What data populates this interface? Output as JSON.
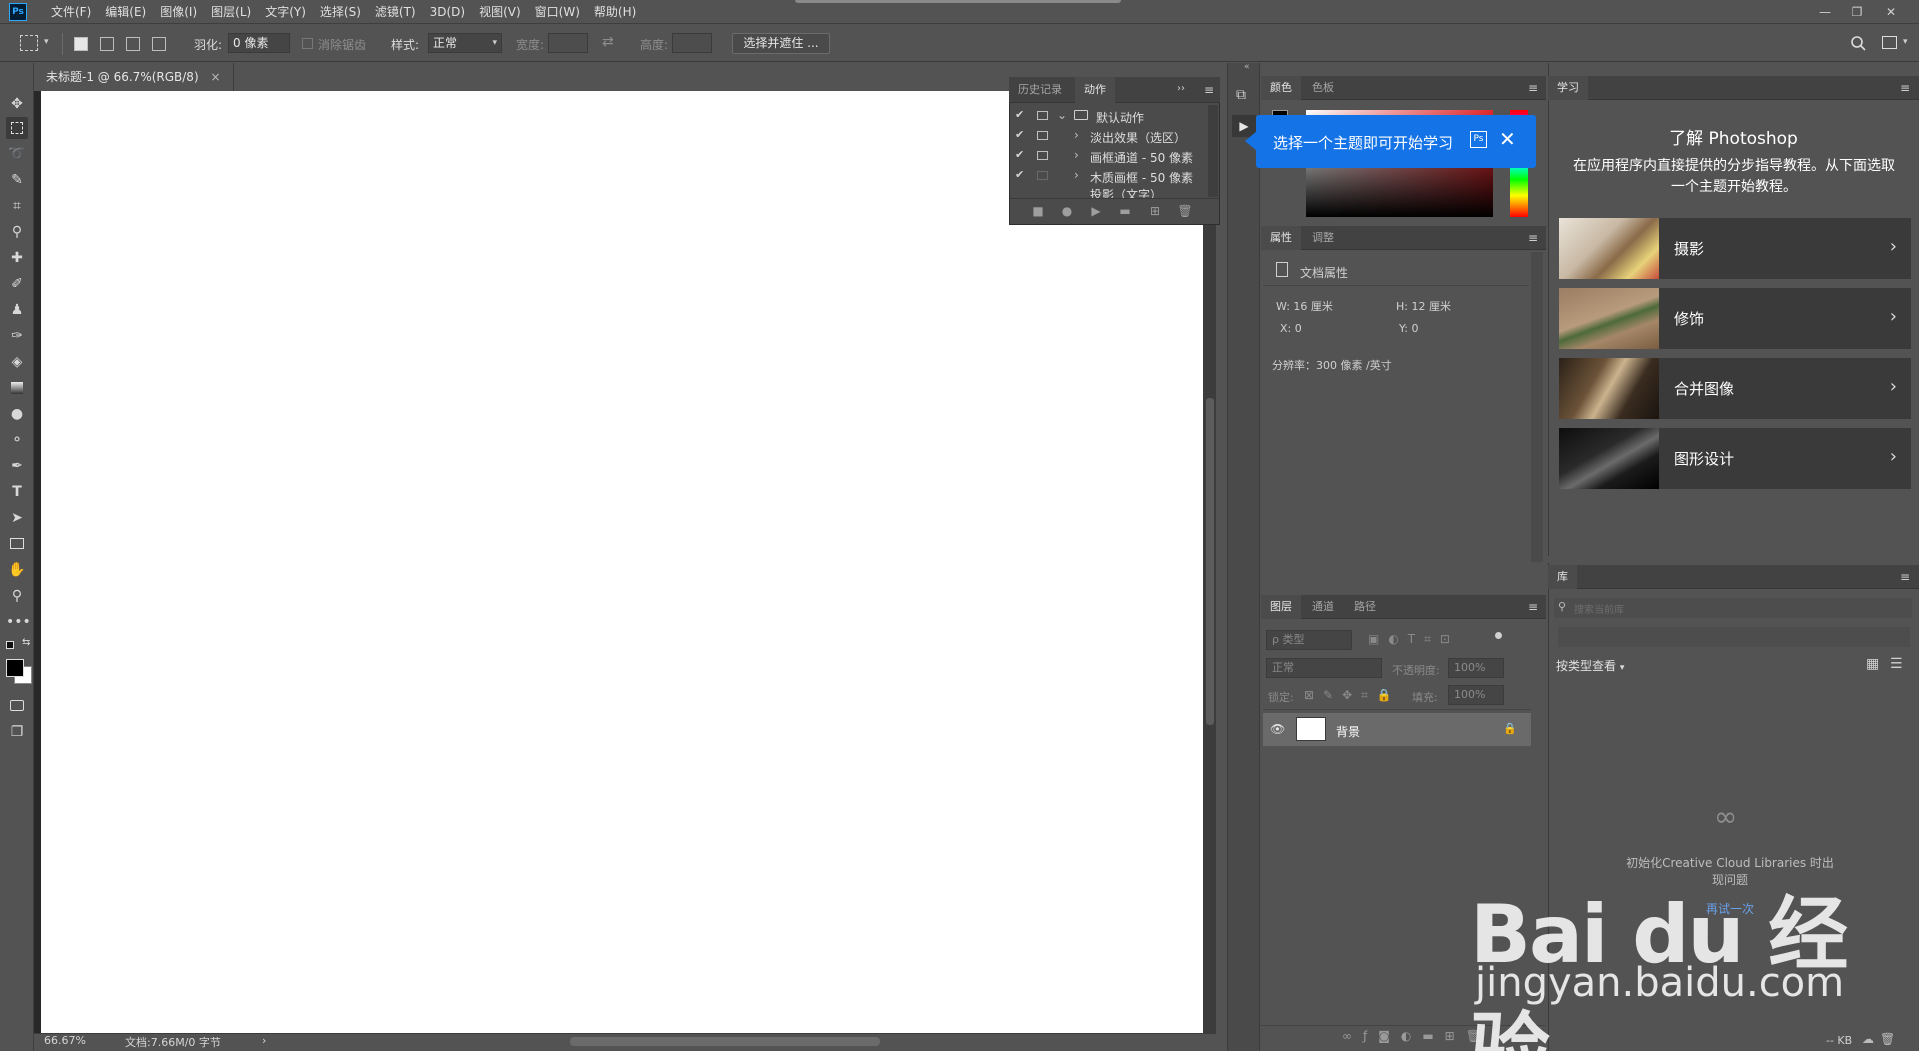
{
  "menubar": {
    "logo": "Ps",
    "items": [
      "文件(F)",
      "编辑(E)",
      "图像(I)",
      "图层(L)",
      "文字(Y)",
      "选择(S)",
      "滤镜(T)",
      "3D(D)",
      "视图(V)",
      "窗口(W)",
      "帮助(H)"
    ],
    "window_controls": [
      "—",
      "❐",
      "✕"
    ]
  },
  "options": {
    "feather_label": "羽化:",
    "feather_value": "0 像素",
    "antialias_label": "消除锯齿",
    "style_label": "样式:",
    "style_value": "正常",
    "width_label": "宽度:",
    "height_label": "高度:",
    "select_mask_button": "选择并遮住 ..."
  },
  "document": {
    "tab_title": "未标题-1 @ 66.7%(RGB/8)",
    "tab_close": "×",
    "zoom": "66.67%",
    "doc_info": "文档:7.66M/0 字节",
    "status_arrow": "›"
  },
  "actions_panel": {
    "tabs": [
      "历史记录",
      "动作"
    ],
    "collapse": "››",
    "set_name": "默认动作",
    "actions": [
      "淡出效果（选区）",
      "画框通道 - 50 像素",
      "木质画框 - 50 像素",
      "投影（文字）"
    ]
  },
  "color_panel": {
    "tabs": [
      "颜色",
      "色板"
    ]
  },
  "learn_tooltip": {
    "text": "选择一个主题即可开始学习",
    "badge": "Ps",
    "close": "✕"
  },
  "properties_panel": {
    "tabs": [
      "属性",
      "调整"
    ],
    "doc_props": "文档属性",
    "w": "W:  16 厘米",
    "h": "H:  12 厘米",
    "x": "X:  0",
    "y": "Y:  0",
    "resolution": "分辨率：300 像素 /英寸"
  },
  "layers_panel": {
    "tabs": [
      "图层",
      "通道",
      "路径"
    ],
    "filter_kind": "ρ 类型",
    "blend_mode": "正常",
    "opacity_label": "不透明度:",
    "opacity_value": "100%",
    "lock_label": "锁定:",
    "fill_label": "填充:",
    "fill_value": "100%",
    "layer_name": "背景"
  },
  "learn_panel": {
    "tab": "学习",
    "heading": "了解 Photoshop",
    "description": "在应用程序内直接提供的分步指导教程。从下面选取一个主题开始教程。",
    "topics": [
      "摄影",
      "修饰",
      "合并图像",
      "图形设计"
    ]
  },
  "library_panel": {
    "tab": "库",
    "search_placeholder": "搜索当前库",
    "view_label": "按类型查看",
    "message": "Creative Cloud Libraries 时出现问题",
    "message_prefix": "初始化",
    "link": "再试一次",
    "size": "-- KB"
  },
  "watermark": {
    "brand": "Bai du 经验",
    "url": "jingyan.baidu.com"
  }
}
